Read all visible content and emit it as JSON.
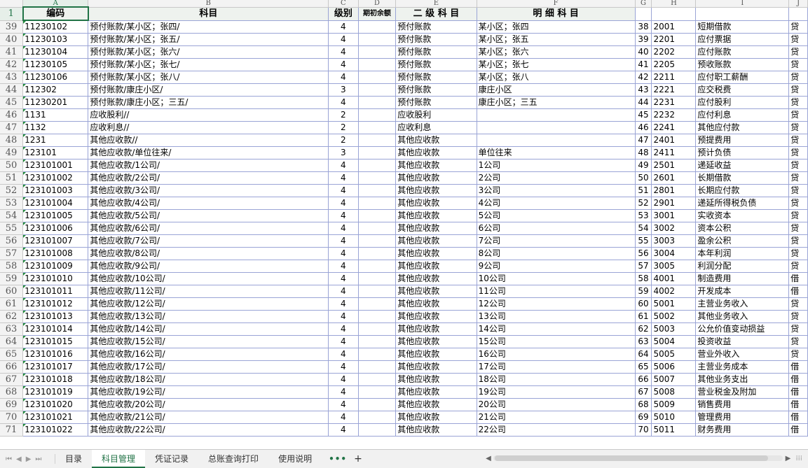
{
  "columns": [
    "A",
    "B",
    "C",
    "D",
    "E",
    "F",
    "G",
    "H",
    "I",
    "J"
  ],
  "header_row": {
    "row_num": "1",
    "code": "编码",
    "subject": "科目",
    "level": "级别",
    "opening": "期初余额",
    "second": "二 级 科 目",
    "detail": "明  细  科  目"
  },
  "rows": [
    {
      "n": "39",
      "a": "11230102",
      "b": "预付账款/某小区；张四/",
      "c": "4",
      "e": "预付账款",
      "f": "某小区；张四",
      "g": "38",
      "h": "2001",
      "i": "短期借款",
      "j": "贷"
    },
    {
      "n": "40",
      "a": "11230103",
      "b": "预付账款/某小区；张五/",
      "c": "4",
      "e": "预付账款",
      "f": "某小区；张五",
      "g": "39",
      "h": "2201",
      "i": "应付票据",
      "j": "贷"
    },
    {
      "n": "41",
      "a": "11230104",
      "b": "预付账款/某小区；张六/",
      "c": "4",
      "e": "预付账款",
      "f": "某小区；张六",
      "g": "40",
      "h": "2202",
      "i": "应付账款",
      "j": "贷"
    },
    {
      "n": "42",
      "a": "11230105",
      "b": "预付账款/某小区；张七/",
      "c": "4",
      "e": "预付账款",
      "f": "某小区；张七",
      "g": "41",
      "h": "2205",
      "i": "预收账款",
      "j": "贷"
    },
    {
      "n": "43",
      "a": "11230106",
      "b": "预付账款/某小区；张八/",
      "c": "4",
      "e": "预付账款",
      "f": "某小区；张八",
      "g": "42",
      "h": "2211",
      "i": "应付职工薪酬",
      "j": "贷"
    },
    {
      "n": "44",
      "a": "112302",
      "b": "预付账款/康庄小区/",
      "c": "3",
      "e": "预付账款",
      "f": "康庄小区",
      "g": "43",
      "h": "2221",
      "i": "应交税费",
      "j": "贷"
    },
    {
      "n": "45",
      "a": "11230201",
      "b": "预付账款/康庄小区；三五/",
      "c": "4",
      "e": "预付账款",
      "f": "康庄小区；三五",
      "g": "44",
      "h": "2231",
      "i": "应付股利",
      "j": "贷"
    },
    {
      "n": "46",
      "a": "1131",
      "b": "应收股利//",
      "c": "2",
      "e": "应收股利",
      "f": "",
      "g": "45",
      "h": "2232",
      "i": "应付利息",
      "j": "贷"
    },
    {
      "n": "47",
      "a": "1132",
      "b": "应收利息//",
      "c": "2",
      "e": "应收利息",
      "f": "",
      "g": "46",
      "h": "2241",
      "i": "其他应付款",
      "j": "贷"
    },
    {
      "n": "48",
      "a": "1231",
      "b": "其他应收款//",
      "c": "2",
      "e": "其他应收款",
      "f": "",
      "g": "47",
      "h": "2401",
      "i": "预提费用",
      "j": "贷"
    },
    {
      "n": "49",
      "a": "123101",
      "b": "其他应收款/单位往来/",
      "c": "3",
      "e": "其他应收款",
      "f": "单位往来",
      "g": "48",
      "h": "2411",
      "i": "预计负债",
      "j": "贷"
    },
    {
      "n": "50",
      "a": "123101001",
      "b": "其他应收款/1公司/",
      "c": "4",
      "e": "其他应收款",
      "f": "1公司",
      "g": "49",
      "h": "2501",
      "i": "递延收益",
      "j": "贷"
    },
    {
      "n": "51",
      "a": "123101002",
      "b": "其他应收款/2公司/",
      "c": "4",
      "e": "其他应收款",
      "f": "2公司",
      "g": "50",
      "h": "2601",
      "i": "长期借款",
      "j": "贷"
    },
    {
      "n": "52",
      "a": "123101003",
      "b": "其他应收款/3公司/",
      "c": "4",
      "e": "其他应收款",
      "f": "3公司",
      "g": "51",
      "h": "2801",
      "i": "长期应付款",
      "j": "贷"
    },
    {
      "n": "53",
      "a": "123101004",
      "b": "其他应收款/4公司/",
      "c": "4",
      "e": "其他应收款",
      "f": "4公司",
      "g": "52",
      "h": "2901",
      "i": "递延所得税负债",
      "j": "贷"
    },
    {
      "n": "54",
      "a": "123101005",
      "b": "其他应收款/5公司/",
      "c": "4",
      "e": "其他应收款",
      "f": "5公司",
      "g": "53",
      "h": "3001",
      "i": "实收资本",
      "j": "贷"
    },
    {
      "n": "55",
      "a": "123101006",
      "b": "其他应收款/6公司/",
      "c": "4",
      "e": "其他应收款",
      "f": "6公司",
      "g": "54",
      "h": "3002",
      "i": "资本公积",
      "j": "贷"
    },
    {
      "n": "56",
      "a": "123101007",
      "b": "其他应收款/7公司/",
      "c": "4",
      "e": "其他应收款",
      "f": "7公司",
      "g": "55",
      "h": "3003",
      "i": "盈余公积",
      "j": "贷"
    },
    {
      "n": "57",
      "a": "123101008",
      "b": "其他应收款/8公司/",
      "c": "4",
      "e": "其他应收款",
      "f": "8公司",
      "g": "56",
      "h": "3004",
      "i": "本年利润",
      "j": "贷"
    },
    {
      "n": "58",
      "a": "123101009",
      "b": "其他应收款/9公司/",
      "c": "4",
      "e": "其他应收款",
      "f": "9公司",
      "g": "57",
      "h": "3005",
      "i": "利润分配",
      "j": "贷"
    },
    {
      "n": "59",
      "a": "123101010",
      "b": "其他应收款/10公司/",
      "c": "4",
      "e": "其他应收款",
      "f": "10公司",
      "g": "58",
      "h": "4001",
      "i": "制造费用",
      "j": "借"
    },
    {
      "n": "60",
      "a": "123101011",
      "b": "其他应收款/11公司/",
      "c": "4",
      "e": "其他应收款",
      "f": "11公司",
      "g": "59",
      "h": "4002",
      "i": "开发成本",
      "j": "借"
    },
    {
      "n": "61",
      "a": "123101012",
      "b": "其他应收款/12公司/",
      "c": "4",
      "e": "其他应收款",
      "f": "12公司",
      "g": "60",
      "h": "5001",
      "i": "主营业务收入",
      "j": "贷"
    },
    {
      "n": "62",
      "a": "123101013",
      "b": "其他应收款/13公司/",
      "c": "4",
      "e": "其他应收款",
      "f": "13公司",
      "g": "61",
      "h": "5002",
      "i": "其他业务收入",
      "j": "贷"
    },
    {
      "n": "63",
      "a": "123101014",
      "b": "其他应收款/14公司/",
      "c": "4",
      "e": "其他应收款",
      "f": "14公司",
      "g": "62",
      "h": "5003",
      "i": "公允价值变动损益",
      "j": "贷"
    },
    {
      "n": "64",
      "a": "123101015",
      "b": "其他应收款/15公司/",
      "c": "4",
      "e": "其他应收款",
      "f": "15公司",
      "g": "63",
      "h": "5004",
      "i": "投资收益",
      "j": "贷"
    },
    {
      "n": "65",
      "a": "123101016",
      "b": "其他应收款/16公司/",
      "c": "4",
      "e": "其他应收款",
      "f": "16公司",
      "g": "64",
      "h": "5005",
      "i": "营业外收入",
      "j": "贷"
    },
    {
      "n": "66",
      "a": "123101017",
      "b": "其他应收款/17公司/",
      "c": "4",
      "e": "其他应收款",
      "f": "17公司",
      "g": "65",
      "h": "5006",
      "i": "主营业务成本",
      "j": "借"
    },
    {
      "n": "67",
      "a": "123101018",
      "b": "其他应收款/18公司/",
      "c": "4",
      "e": "其他应收款",
      "f": "18公司",
      "g": "66",
      "h": "5007",
      "i": "其他业务支出",
      "j": "借"
    },
    {
      "n": "68",
      "a": "123101019",
      "b": "其他应收款/19公司/",
      "c": "4",
      "e": "其他应收款",
      "f": "19公司",
      "g": "67",
      "h": "5008",
      "i": "营业税金及附加",
      "j": "借"
    },
    {
      "n": "69",
      "a": "123101020",
      "b": "其他应收款/20公司/",
      "c": "4",
      "e": "其他应收款",
      "f": "20公司",
      "g": "68",
      "h": "5009",
      "i": "销售费用",
      "j": "借"
    },
    {
      "n": "70",
      "a": "123101021",
      "b": "其他应收款/21公司/",
      "c": "4",
      "e": "其他应收款",
      "f": "21公司",
      "g": "69",
      "h": "5010",
      "i": "管理费用",
      "j": "借"
    },
    {
      "n": "71",
      "a": "123101022",
      "b": "其他应收款/22公司/",
      "c": "4",
      "e": "其他应收款",
      "f": "22公司",
      "g": "70",
      "h": "5011",
      "i": "财务费用",
      "j": "借"
    }
  ],
  "sheet_tabs": [
    "目录",
    "科目管理",
    "凭证记录",
    "总账查询打印",
    "使用说明"
  ],
  "active_tab": "科目管理",
  "tab_more": "•••",
  "tab_add": "+",
  "icons": {
    "first_sheet": "first-sheet-icon",
    "prev_sheet": "prev-sheet-icon",
    "next_sheet": "next-sheet-icon",
    "last_sheet": "last-sheet-icon"
  },
  "colors": {
    "accent": "#217346",
    "gridline": "#9aa4d6"
  }
}
